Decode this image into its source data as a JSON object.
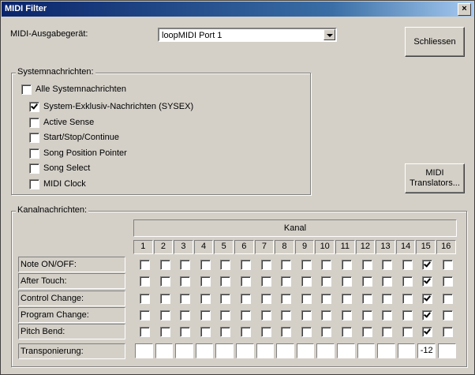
{
  "window": {
    "title": "MIDI Filter",
    "close_glyph": "×"
  },
  "output": {
    "label": "MIDI-Ausgabegerät:",
    "selected": "loopMIDI Port 1"
  },
  "buttons": {
    "close": "Schliessen",
    "translators_line1": "MIDI",
    "translators_line2": "Translators..."
  },
  "system": {
    "title": "Systemnachrichten:",
    "all": {
      "label": "Alle Systemnachrichten",
      "checked": false
    },
    "items": [
      {
        "label": "System-Exklusiv-Nachrichten (SYSEX)",
        "checked": true
      },
      {
        "label": "Active Sense",
        "checked": false
      },
      {
        "label": "Start/Stop/Continue",
        "checked": false
      },
      {
        "label": "Song Position Pointer",
        "checked": false
      },
      {
        "label": "Song Select",
        "checked": false
      },
      {
        "label": "MIDI Clock",
        "checked": false
      }
    ]
  },
  "channel": {
    "title": "Kanalnachrichten:",
    "header": "Kanal",
    "channels": [
      "1",
      "2",
      "3",
      "4",
      "5",
      "6",
      "7",
      "8",
      "9",
      "10",
      "11",
      "12",
      "13",
      "14",
      "15",
      "16"
    ],
    "rows": [
      {
        "label": "Note ON/OFF:",
        "checked": [
          false,
          false,
          false,
          false,
          false,
          false,
          false,
          false,
          false,
          false,
          false,
          false,
          false,
          false,
          true,
          false
        ]
      },
      {
        "label": "After Touch:",
        "checked": [
          false,
          false,
          false,
          false,
          false,
          false,
          false,
          false,
          false,
          false,
          false,
          false,
          false,
          false,
          true,
          false
        ]
      },
      {
        "label": "Control Change:",
        "checked": [
          false,
          false,
          false,
          false,
          false,
          false,
          false,
          false,
          false,
          false,
          false,
          false,
          false,
          false,
          true,
          false
        ]
      },
      {
        "label": "Program Change:",
        "checked": [
          false,
          false,
          false,
          false,
          false,
          false,
          false,
          false,
          false,
          false,
          false,
          false,
          false,
          false,
          true,
          false
        ]
      },
      {
        "label": "Pitch Bend:",
        "checked": [
          false,
          false,
          false,
          false,
          false,
          false,
          false,
          false,
          false,
          false,
          false,
          false,
          false,
          false,
          true,
          false
        ]
      }
    ],
    "transpose": {
      "label": "Transponierung:",
      "values": [
        "",
        "",
        "",
        "",
        "",
        "",
        "",
        "",
        "",
        "",
        "",
        "",
        "",
        "",
        "-12",
        ""
      ]
    }
  }
}
